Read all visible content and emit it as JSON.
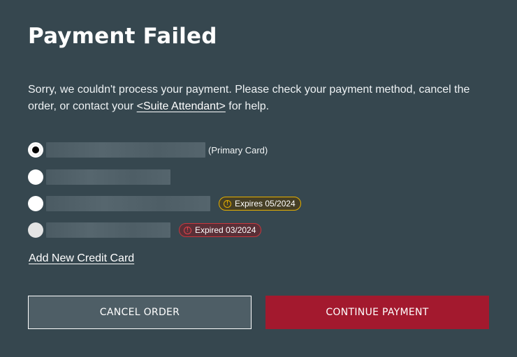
{
  "dialog": {
    "title": "Payment Failed",
    "message_before": "Sorry, we couldn't process your payment. Please check your payment method, cancel the order, or contact your ",
    "message_link": "<Suite Attendant>",
    "message_after": " for help."
  },
  "cards": [
    {
      "selected": true,
      "disabled": false,
      "label": "(Primary Card)",
      "badge": null
    },
    {
      "selected": false,
      "disabled": false,
      "label": "",
      "badge": null
    },
    {
      "selected": false,
      "disabled": false,
      "label": "",
      "badge": {
        "type": "warning",
        "text": "Expires 05/2024",
        "color": "#e6b000",
        "icon": "info-icon"
      }
    },
    {
      "selected": false,
      "disabled": true,
      "label": "",
      "badge": {
        "type": "error",
        "text": "Expired 03/2024",
        "color": "#c8373e",
        "icon": "info-icon"
      }
    }
  ],
  "add_card_label": "Add New Credit Card",
  "buttons": {
    "cancel_label": "CANCEL ORDER",
    "continue_label": "CONTINUE PAYMENT"
  },
  "colors": {
    "background": "#36474f",
    "primary_accent": "#a3192e",
    "warning": "#e6b000",
    "error": "#c8373e"
  }
}
